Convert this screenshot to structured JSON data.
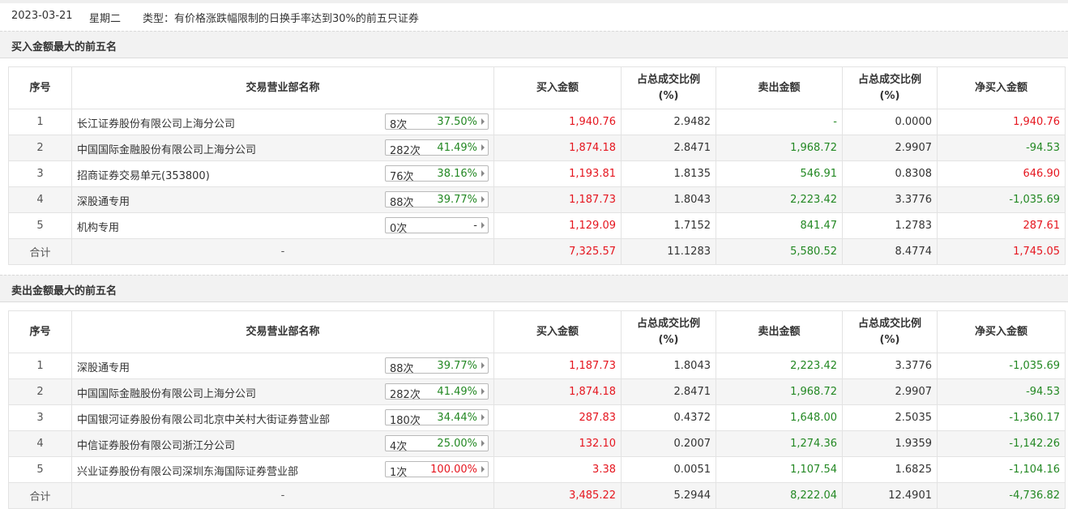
{
  "header": {
    "date": "2023-03-21",
    "weekday": "星期二",
    "type_text": "类型：有价格涨跌幅限制的日换手率达到30%的前五只证券"
  },
  "colors": {
    "up": "#e5161f",
    "down": "#238823"
  },
  "columns": {
    "seq": "序号",
    "name": "交易营业部名称",
    "buy": "买入金额",
    "buy_ratio_l1": "占总成交比例",
    "buy_ratio_l2": "(%)",
    "sell": "卖出金额",
    "sell_ratio_l1": "占总成交比例",
    "sell_ratio_l2": "(%)",
    "net": "净买入金额"
  },
  "buy_section": {
    "title": "买入金额最大的前五名",
    "rows": [
      {
        "seq": "1",
        "name": "长江证券股份有限公司上海分公司",
        "count": "8次",
        "pct": "37.50%",
        "pct_color": "green",
        "buy": "1,940.76",
        "buy_ratio": "2.9482",
        "sell": "-",
        "sell_color": "green",
        "sell_ratio": "0.0000",
        "net": "1,940.76",
        "net_color": "red"
      },
      {
        "seq": "2",
        "name": "中国国际金融股份有限公司上海分公司",
        "count": "282次",
        "pct": "41.49%",
        "pct_color": "green",
        "buy": "1,874.18",
        "buy_ratio": "2.8471",
        "sell": "1,968.72",
        "sell_color": "green",
        "sell_ratio": "2.9907",
        "net": "-94.53",
        "net_color": "green"
      },
      {
        "seq": "3",
        "name": "招商证券交易单元(353800)",
        "count": "76次",
        "pct": "38.16%",
        "pct_color": "green",
        "buy": "1,193.81",
        "buy_ratio": "1.8135",
        "sell": "546.91",
        "sell_color": "green",
        "sell_ratio": "0.8308",
        "net": "646.90",
        "net_color": "red"
      },
      {
        "seq": "4",
        "name": "深股通专用",
        "count": "88次",
        "pct": "39.77%",
        "pct_color": "green",
        "buy": "1,187.73",
        "buy_ratio": "1.8043",
        "sell": "2,223.42",
        "sell_color": "green",
        "sell_ratio": "3.3776",
        "net": "-1,035.69",
        "net_color": "green"
      },
      {
        "seq": "5",
        "name": "机构专用",
        "count": "0次",
        "pct": "-",
        "pct_color": "dark",
        "buy": "1,129.09",
        "buy_ratio": "1.7152",
        "sell": "841.47",
        "sell_color": "green",
        "sell_ratio": "1.2783",
        "net": "287.61",
        "net_color": "red"
      }
    ],
    "total": {
      "label": "合计",
      "name": "-",
      "buy": "7,325.57",
      "buy_ratio": "11.1283",
      "sell": "5,580.52",
      "sell_ratio": "8.4774",
      "net": "1,745.05",
      "net_color": "red"
    }
  },
  "sell_section": {
    "title": "卖出金额最大的前五名",
    "rows": [
      {
        "seq": "1",
        "name": "深股通专用",
        "count": "88次",
        "pct": "39.77%",
        "pct_color": "green",
        "buy": "1,187.73",
        "buy_ratio": "1.8043",
        "sell": "2,223.42",
        "sell_color": "green",
        "sell_ratio": "3.3776",
        "net": "-1,035.69",
        "net_color": "green"
      },
      {
        "seq": "2",
        "name": "中国国际金融股份有限公司上海分公司",
        "count": "282次",
        "pct": "41.49%",
        "pct_color": "green",
        "buy": "1,874.18",
        "buy_ratio": "2.8471",
        "sell": "1,968.72",
        "sell_color": "green",
        "sell_ratio": "2.9907",
        "net": "-94.53",
        "net_color": "green"
      },
      {
        "seq": "3",
        "name": "中国银河证券股份有限公司北京中关村大街证券营业部",
        "count": "180次",
        "pct": "34.44%",
        "pct_color": "green",
        "buy": "287.83",
        "buy_ratio": "0.4372",
        "sell": "1,648.00",
        "sell_color": "green",
        "sell_ratio": "2.5035",
        "net": "-1,360.17",
        "net_color": "green"
      },
      {
        "seq": "4",
        "name": "中信证券股份有限公司浙江分公司",
        "count": "4次",
        "pct": "25.00%",
        "pct_color": "green",
        "buy": "132.10",
        "buy_ratio": "0.2007",
        "sell": "1,274.36",
        "sell_color": "green",
        "sell_ratio": "1.9359",
        "net": "-1,142.26",
        "net_color": "green"
      },
      {
        "seq": "5",
        "name": "兴业证券股份有限公司深圳东海国际证券营业部",
        "count": "1次",
        "pct": "100.00%",
        "pct_color": "red",
        "buy": "3.38",
        "buy_ratio": "0.0051",
        "sell": "1,107.54",
        "sell_color": "green",
        "sell_ratio": "1.6825",
        "net": "-1,104.16",
        "net_color": "green"
      }
    ],
    "total": {
      "label": "合计",
      "name": "-",
      "buy": "3,485.22",
      "buy_ratio": "5.2944",
      "sell": "8,222.04",
      "sell_ratio": "12.4901",
      "net": "-4,736.82",
      "net_color": "green"
    }
  }
}
